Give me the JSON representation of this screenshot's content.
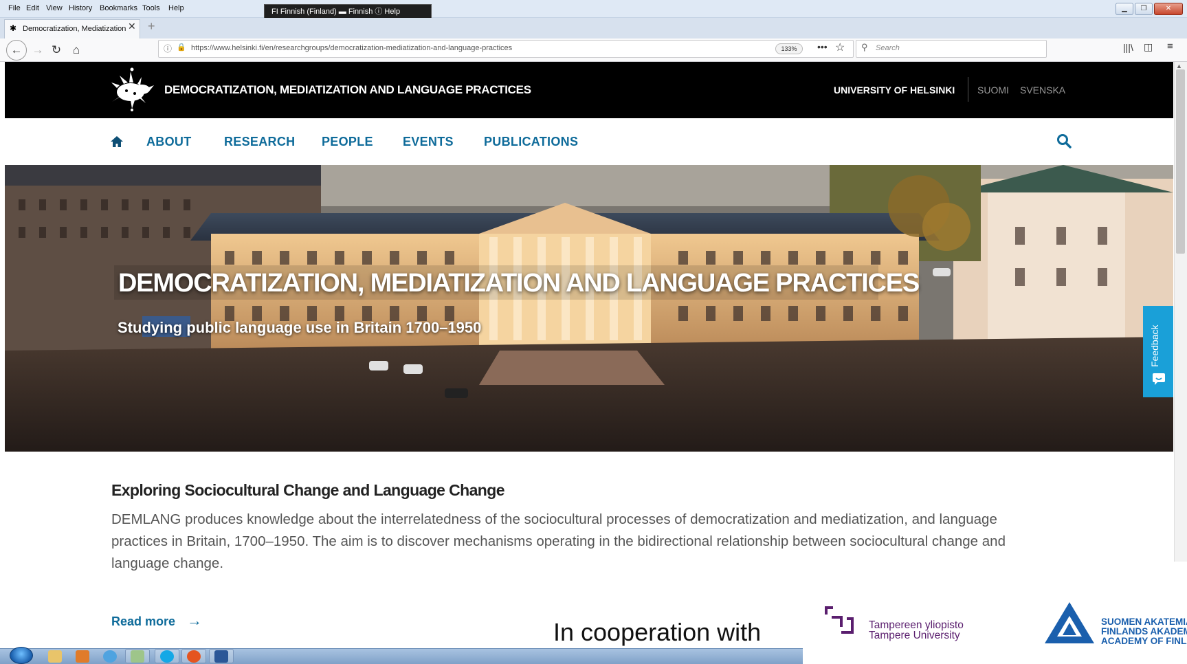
{
  "browser": {
    "menu": [
      "File",
      "Edit",
      "View",
      "History",
      "Bookmarks",
      "Tools",
      "Help"
    ],
    "language_bar": "FI  Finnish (Finland)   ▬ Finnish   ⓘ Help",
    "tab_title": "Democratization, Mediatization",
    "url": "https://www.helsinki.fi/en/researchgroups/democratization-mediatization-and-language-practices",
    "zoom": "133%",
    "search_placeholder": "Search"
  },
  "site": {
    "title": "DEMOCRATIZATION, MEDIATIZATION AND LANGUAGE PRACTICES",
    "university": "UNIVERSITY OF HELSINKI",
    "lang_suomi": "SUOMI",
    "lang_svenska": "SVENSKA",
    "nav": [
      "ABOUT",
      "RESEARCH",
      "PEOPLE",
      "EVENTS",
      "PUBLICATIONS"
    ]
  },
  "hero": {
    "title": "DEMOCRATIZATION, MEDIATIZATION AND LANGUAGE PRACTICES",
    "subtitle": "Studying public language use in Britain 1700–1950"
  },
  "feedback_label": "Feedback",
  "content": {
    "heading": "Exploring Sociocultural Change and Language Change",
    "body": "DEMLANG produces knowledge about the interrelatedness of the sociocultural processes of democratization and mediatization, and language practices in Britain, 1700–1950. The aim is to discover mechanisms operating in the bidirectional relationship between sociocultural change and language change.",
    "read_more": "Read more",
    "read_more_arrow": "→"
  },
  "cooperation": {
    "label": "In cooperation with",
    "tampere_fi": "Tampereen yliopisto",
    "tampere_en": "Tampere University",
    "academy": [
      "SUOMEN AKATEMIA",
      "FINLANDS AKADEMI",
      "ACADEMY OF FINLAND"
    ]
  },
  "colors": {
    "nav_blue": "#0e6b9a",
    "feedback_blue": "#1aa0d8",
    "header_black": "#000000"
  }
}
